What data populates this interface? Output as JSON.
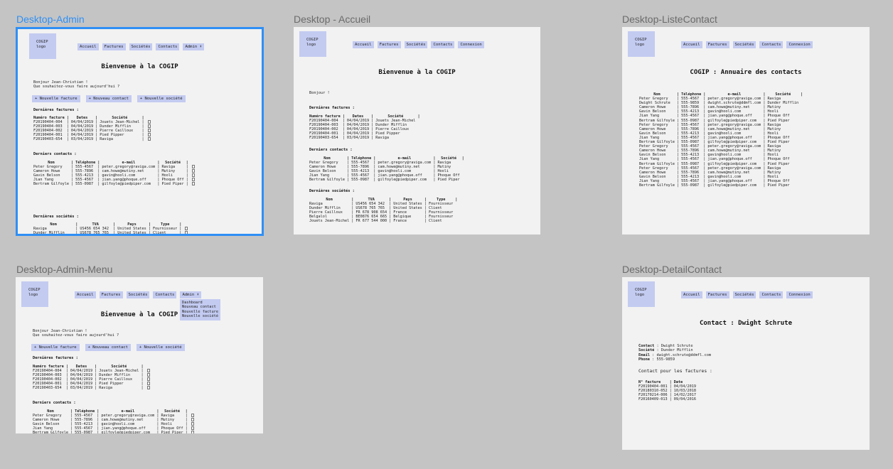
{
  "frames": {
    "admin": {
      "title": "Desktop-Admin"
    },
    "accueil": {
      "title": "Desktop - Accueil"
    },
    "liste": {
      "title": "Desktop-ListeContact"
    },
    "admin_menu": {
      "title": "Desktop-Admin-Menu"
    },
    "detail": {
      "title": "Desktop-DetailContact"
    }
  },
  "logo": {
    "line1": "COGIP",
    "line2": "logo"
  },
  "nav": {
    "admin_items": [
      "Accueil",
      "Factures",
      "Sociétés",
      "Contacts",
      "Admin ⬇"
    ],
    "public_items": [
      "Accueil",
      "Factures",
      "Sociétés",
      "Contacts",
      "Connexion"
    ]
  },
  "welcome_title": "Bienvenue à la COGIP",
  "greeting_admin": "Bonjour Jean-Christian !\nQue souhaitez-vous faire aujourd'hui ?",
  "greeting_public": "Bonjour !",
  "actions": [
    "+ Nouvelle facture",
    "+ Nouveau contact",
    "+ Nouvelle société"
  ],
  "sections": {
    "factures": "Dernières factures :",
    "contacts": "Derniers contacts :",
    "societes": "Dernières sociétés :"
  },
  "invoice_headers": [
    "Numéro facture",
    "Dates",
    "Société"
  ],
  "invoices": [
    [
      "F20190404-004",
      "04/04/2019",
      "Jouets Jean-Michel"
    ],
    [
      "F20190404-003",
      "04/04/2019",
      "Dunder Mifflin"
    ],
    [
      "F20190404-002",
      "04/04/2019",
      "Pierre Cailloux"
    ],
    [
      "F20190404-001",
      "04/04/2019",
      "Pied Pipper"
    ],
    [
      "F20190403-654",
      "03/04/2019",
      "Raviga"
    ]
  ],
  "contact_headers": [
    "Nom",
    "Téléphone",
    "e-mail",
    "Société"
  ],
  "contacts": [
    [
      "Peter Gregory",
      "555-4567",
      "peter.gregory@raviga.com",
      "Raviga"
    ],
    [
      "Cameron Howe",
      "555-7896",
      "cam.howe@mutiny.net",
      "Mutiny"
    ],
    [
      "Gavin Belson",
      "555-4213",
      "gavin@hooli.com",
      "Hooli"
    ],
    [
      "Jian Yang",
      "555-4567",
      "jian.yang@phoque.off",
      "Phoque Off"
    ],
    [
      "Bertram Gilfoyle",
      "555-0987",
      "gilfoyle@piedpiper.com",
      "Pied Piper"
    ]
  ],
  "company_headers": [
    "Nom",
    "TVA",
    "Pays",
    "Type"
  ],
  "companies": [
    [
      "Raviga",
      "US456 654 342",
      "United States",
      "Fournisseur"
    ],
    [
      "Dunder Mifflin",
      "US678 765 765",
      "United States",
      "Client"
    ],
    [
      "Pierre Cailloux",
      "FR 678 908 654",
      "France",
      "Fournisseur"
    ],
    [
      "Belgalol",
      "BE0876 654 665",
      "Belgique",
      "Fournisseur"
    ],
    [
      "Jouets Jean-Michel",
      "FR 677 544 000",
      "France",
      "Client"
    ]
  ],
  "annuaire_title": "COGIP : Annuaire des contacts",
  "annuaire": [
    [
      "Peter Gregory",
      "555-4567",
      "peter.gregory@raviga.com",
      "Raviga"
    ],
    [
      "Dwight Schrute",
      "555-9859",
      "dwight.schrute@ddmfl.com",
      "Dunder Mifflin"
    ],
    [
      "Cameron Howe",
      "555-7896",
      "cam.howe@mutiny.net",
      "Mutiny"
    ],
    [
      "Gavin Belson",
      "555-4213",
      "gavin@hooli.com",
      "Hooli"
    ],
    [
      "Jian Yang",
      "555-4567",
      "jian.yang@phoque.off",
      "Phoque Off"
    ],
    [
      "Bertram Gilfoyle",
      "555-0987",
      "gilfoyle@piedpiper.com",
      "Pied Piper"
    ],
    [
      "Peter Gregory",
      "555-4567",
      "peter.gregory@raviga.com",
      "Raviga"
    ],
    [
      "Cameron Howe",
      "555-7896",
      "cam.howe@mutiny.net",
      "Mutiny"
    ],
    [
      "Gavin Belson",
      "555-4213",
      "gavin@hooli.com",
      "Hooli"
    ],
    [
      "Jian Yang",
      "555-4567",
      "jian.yang@phoque.off",
      "Phoque Off"
    ],
    [
      "Bertram Gilfoyle",
      "555-0987",
      "gilfoyle@piedpiper.com",
      "Pied Piper"
    ],
    [
      "Peter Gregory",
      "555-4567",
      "peter.gregory@raviga.com",
      "Raviga"
    ],
    [
      "Cameron Howe",
      "555-7896",
      "cam.howe@mutiny.net",
      "Mutiny"
    ],
    [
      "Gavin Belson",
      "555-4213",
      "gavin@hooli.com",
      "Hooli"
    ],
    [
      "Jian Yang",
      "555-4567",
      "jian.yang@phoque.off",
      "Phoque Off"
    ],
    [
      "Bertram Gilfoyle",
      "555-0987",
      "gilfoyle@piedpiper.com",
      "Pied Piper"
    ],
    [
      "Peter Gregory",
      "555-4567",
      "peter.gregory@raviga.com",
      "Raviga"
    ],
    [
      "Cameron Howe",
      "555-7896",
      "cam.howe@mutiny.net",
      "Mutiny"
    ],
    [
      "Gavin Belson",
      "555-4213",
      "gavin@hooli.com",
      "Hooli"
    ],
    [
      "Jian Yang",
      "555-4567",
      "jian.yang@phoque.off",
      "Phoque Off"
    ],
    [
      "Bertram Gilfoyle",
      "555-0987",
      "gilfoyle@piedpiper.com",
      "Pied Piper"
    ]
  ],
  "admin_menu_items": "Dashboard\nNouveau contact\nNouvelle facture\nNouvelle société",
  "detail": {
    "title": "Contact : Dwight Schrute",
    "fields": [
      [
        "Contact",
        "Dwight Schrute"
      ],
      [
        "Société",
        "Dunder Mifflin"
      ],
      [
        "Email",
        "dwight.schrute@ddmfl.com"
      ],
      [
        "Phone",
        "555-9859"
      ]
    ],
    "invoices_label": "Contact pour les factures :",
    "invoice_headers": [
      "N° facture",
      "Date"
    ],
    "invoices": [
      [
        "F20190404-001",
        "04/04/2019"
      ],
      [
        "F20180310-052",
        "10/03/2018"
      ],
      [
        "F20170214-006",
        "14/02/2017"
      ],
      [
        "F20160409-013",
        "09/04/2016"
      ]
    ]
  },
  "colors": {
    "canvas": "#c4c4c4",
    "frame": "#f2f2f2",
    "accent": "#c3cbf1",
    "selection": "#2f8ff5"
  }
}
